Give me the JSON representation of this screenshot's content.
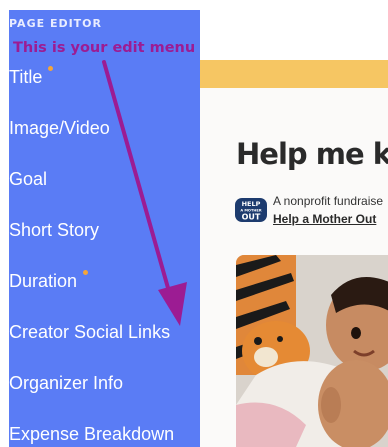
{
  "sidebar": {
    "heading": "PAGE EDITOR",
    "annotation": "This is your edit menu",
    "items": [
      {
        "label": "Title",
        "dot": true
      },
      {
        "label": "Image/Video",
        "dot": false
      },
      {
        "label": "Goal",
        "dot": false
      },
      {
        "label": "Short Story",
        "dot": false
      },
      {
        "label": "Duration",
        "dot": true
      },
      {
        "label": "Creator Social Links",
        "dot": false
      },
      {
        "label": "Organizer Info",
        "dot": false
      },
      {
        "label": "Expense Breakdown",
        "dot": false
      }
    ]
  },
  "main": {
    "title": "Help me ke",
    "organizer": {
      "description": "A nonprofit fundraise",
      "link": "Help a Mother Out",
      "logo_text": [
        "HELP",
        "A MOTHER",
        "OUT"
      ]
    }
  },
  "colors": {
    "sidebar": "#5a7cf5",
    "annotation": "#9c1c93",
    "banner": "#f6c663",
    "dot": "#f4a53a"
  }
}
